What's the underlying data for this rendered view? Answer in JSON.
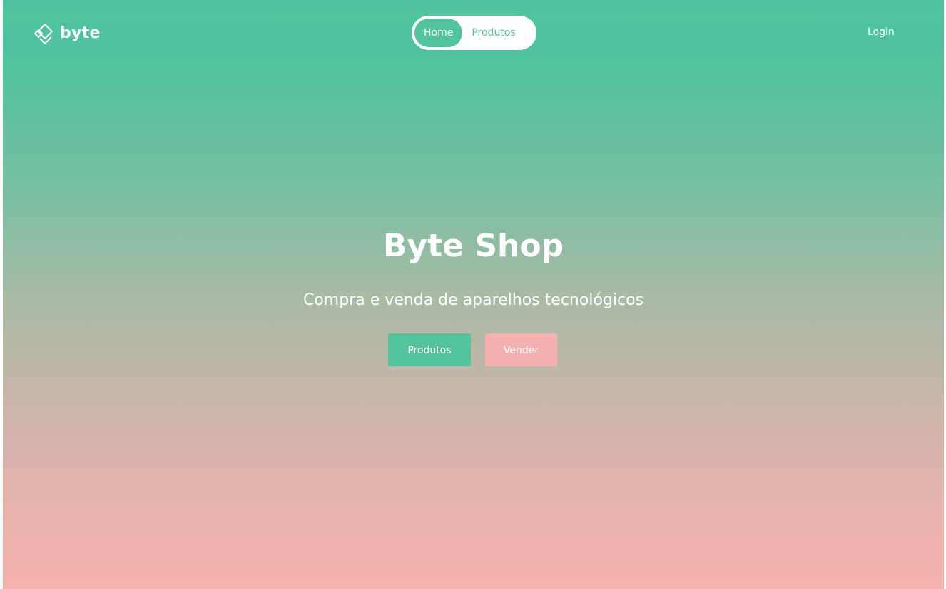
{
  "brand": {
    "name": "byte",
    "logo_icon": "diamond-logo-icon"
  },
  "nav": {
    "items": [
      {
        "label": "Home",
        "active": true
      },
      {
        "label": "Produtos",
        "active": false
      }
    ],
    "login_label": "Login"
  },
  "hero": {
    "title": "Byte Shop",
    "subtitle": "Compra e venda de aparelhos tecnológicos",
    "buttons": {
      "products_label": "Produtos",
      "sell_label": "Vender"
    }
  },
  "colors": {
    "primary_green": "#52c29f",
    "accent_pink": "#f5b1af",
    "text_white": "#ffffff"
  }
}
